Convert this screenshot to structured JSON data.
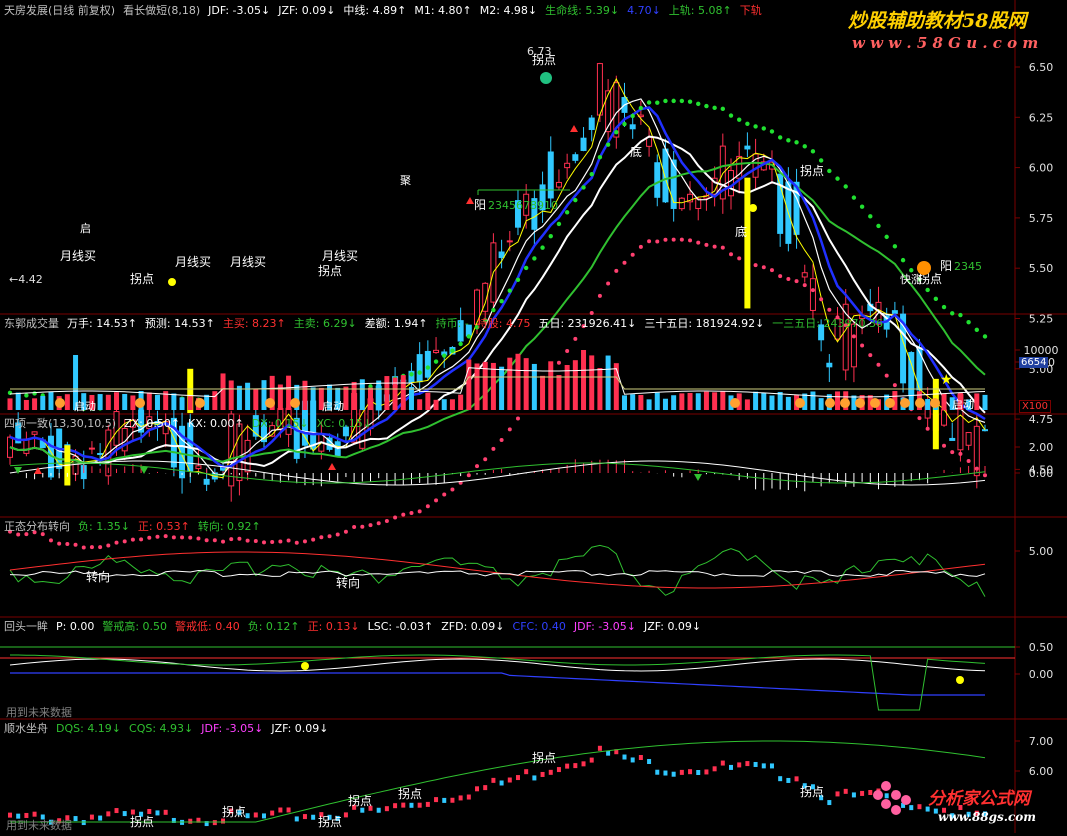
{
  "colors": {
    "bg": "#000000",
    "grid": "#7a0000",
    "up": "#ff3050",
    "down": "#30c8ff",
    "white": "#ffffff",
    "yellow": "#ffff00",
    "green": "#30c030",
    "lgreen": "#20e030",
    "magenta": "#ff40ff",
    "pink": "#ff4070",
    "blue": "#3040ff",
    "text": "#c0c0c0"
  },
  "watermark": {
    "top": "炒股辅助教材58股网",
    "top_url": "w w w . 5 8 G u . c o m",
    "bottom": "分析家公式网",
    "bottom_url": "www.88gs.com"
  },
  "panel1": {
    "items": [
      {
        "t": "天房发展(日线 前复权)",
        "c": "#c0c0c0"
      },
      {
        "t": "看长做短(8,18)",
        "c": "#c0c0c0"
      },
      {
        "t": "JDF: -3.05↓",
        "c": "#ffffff"
      },
      {
        "t": "JZF: 0.09↓",
        "c": "#ffffff"
      },
      {
        "t": "中线: 4.89↑",
        "c": "#ffffff"
      },
      {
        "t": "M1: 4.80↑",
        "c": "#ffffff"
      },
      {
        "t": "M2: 4.98↓",
        "c": "#ffffff"
      },
      {
        "t": "生命线: 5.39↓",
        "c": "#30c030"
      },
      {
        "t": "4.70↓",
        "c": "#3040ff"
      },
      {
        "t": "上轨: 5.08↑",
        "c": "#30c030"
      },
      {
        "t": "下轨",
        "c": "#ff3030"
      }
    ],
    "y_ticks": [
      "6.50",
      "6.25",
      "6.00",
      "5.75",
      "5.50",
      "5.25",
      "5.00",
      "4.75",
      "4.50"
    ],
    "labels": {
      "hi": "6.73",
      "lo": "←4.42",
      "turn": "拐点",
      "bottom": "底",
      "yang": "阳",
      "yang_seq": "2345678910",
      "yang_seq2": "2345",
      "month_buy": "月线买",
      "month_buy2": "月线买",
      "month_buy3": "月线买",
      "month_buy4": "月线买",
      "ju": "聚",
      "turn2": "拐点",
      "turn3": "拐点",
      "turn4": "拐点",
      "turn5": "拐点",
      "bottom2": "底",
      "quick_rise": "快涨",
      "start": "启"
    }
  },
  "panel2": {
    "items": [
      {
        "t": "东郭成交量",
        "c": "#c0c0c0"
      },
      {
        "t": "万手: 14.53↑",
        "c": "#ffffff"
      },
      {
        "t": "预测: 14.53↑",
        "c": "#ffffff"
      },
      {
        "t": "主买: 8.23↑",
        "c": "#ff3030"
      },
      {
        "t": "主卖: 6.29↓",
        "c": "#30c030"
      },
      {
        "t": "差额: 1.94↑",
        "c": "#ffffff"
      },
      {
        "t": "持币: -",
        "c": "#30c030"
      },
      {
        "t": "持股: 4.75",
        "c": "#ff3030"
      },
      {
        "t": "五日: 231926.41↓",
        "c": "#ffffff"
      },
      {
        "t": "三十五日: 181924.92↓",
        "c": "#ffffff"
      },
      {
        "t": "一三五日: 243970.36",
        "c": "#30c030"
      }
    ],
    "y_ticks": [
      "10000",
      "5000"
    ],
    "current": "6654",
    "unit": "X100",
    "labels": {
      "start": "启动",
      "start2": "启动",
      "start3": "启动"
    }
  },
  "panel3": {
    "items": [
      {
        "t": "四项一致(13,30,10,5)",
        "c": "#c0c0c0"
      },
      {
        "t": "ZX: 0.50↑",
        "c": "#ffffff"
      },
      {
        "t": "KX: 0.00↑",
        "c": "#ffffff"
      },
      {
        "t": "DX: 0.15↓",
        "c": "#30c030"
      },
      {
        "t": "XC: 0.15↓",
        "c": "#30c030"
      }
    ],
    "y_ticks": [
      "2.00",
      "0.00"
    ]
  },
  "panel4": {
    "items": [
      {
        "t": "正态分布转向",
        "c": "#c0c0c0"
      },
      {
        "t": "负: 1.35↓",
        "c": "#30c030"
      },
      {
        "t": "正: 0.53↑",
        "c": "#ff3030"
      },
      {
        "t": "转向: 0.92↑",
        "c": "#30c030"
      }
    ],
    "y_ticks": [
      "5.00"
    ],
    "labels": {
      "turn": "转向",
      "turn2": "转向"
    }
  },
  "panel5": {
    "items": [
      {
        "t": "回头一眸",
        "c": "#c0c0c0"
      },
      {
        "t": "P: 0.00",
        "c": "#ffffff"
      },
      {
        "t": "警戒高: 0.50",
        "c": "#30c030"
      },
      {
        "t": "警戒低: 0.40",
        "c": "#ff3030"
      },
      {
        "t": "负: 0.12↑",
        "c": "#30c030"
      },
      {
        "t": "正: 0.13↓",
        "c": "#ff3030"
      },
      {
        "t": "LSC: -0.03↑",
        "c": "#ffffff"
      },
      {
        "t": "ZFD: 0.09↓",
        "c": "#ffffff"
      },
      {
        "t": "CFC: 0.40",
        "c": "#3040ff"
      },
      {
        "t": "JDF: -3.05↓",
        "c": "#ff40ff"
      },
      {
        "t": "JZF: 0.09↓",
        "c": "#ffffff"
      }
    ],
    "y_ticks": [
      "0.50",
      "0.00"
    ],
    "footer": "用到未来数据"
  },
  "panel6": {
    "items": [
      {
        "t": "顺水坐舟",
        "c": "#c0c0c0"
      },
      {
        "t": "DQS: 4.19↓",
        "c": "#30c030"
      },
      {
        "t": "CQS: 4.93↓",
        "c": "#30c030"
      },
      {
        "t": "JDF: -3.05↓",
        "c": "#ff40ff"
      },
      {
        "t": "JZF: 0.09↓",
        "c": "#ffffff"
      }
    ],
    "y_ticks": [
      "7.00",
      "6.00"
    ],
    "footer": "用到未来数据",
    "labels": {
      "turn": "拐点",
      "turn2": "拐点",
      "turn3": "拐点",
      "turn4": "拐点",
      "turn5": "拐点",
      "turn6": "拐点",
      "turn7": "拐点"
    }
  },
  "chart_data": {
    "type": "candlestick",
    "title": "天房发展(日线 前复权)",
    "y_range": [
      4.42,
      6.73
    ],
    "high": 6.73,
    "low": 4.42,
    "last": {
      "jdf": -3.05,
      "jzf": 0.09,
      "mid_line": 4.89,
      "m1": 4.8,
      "m2": 4.98,
      "life_line": 5.39,
      "upper_rail": 5.08
    },
    "volume": {
      "wan_shou": 14.53,
      "forecast": 14.53,
      "main_buy": 8.23,
      "main_sell": 6.29,
      "diff": 1.94,
      "hold_stock": 4.75,
      "ma5": 231926.41,
      "ma35": 181924.92,
      "ma135": 243970.36,
      "current": 6654
    },
    "indicators": {
      "four_consistent": {
        "zx": 0.5,
        "kx": 0.0,
        "dx": 0.15,
        "xc": 0.15
      },
      "normal_turn": {
        "neg": 1.35,
        "pos": 0.53,
        "turn": 0.92
      },
      "look_back": {
        "p": 0.0,
        "warn_high": 0.5,
        "warn_low": 0.4,
        "neg": 0.12,
        "pos": 0.13,
        "lsc": -0.03,
        "zfd": 0.09,
        "cfc": 0.4,
        "jdf": -3.05,
        "jzf": 0.09
      },
      "go_with_flow": {
        "dqs": 4.19,
        "cqs": 4.93,
        "jdf": -3.05,
        "jzf": 0.09
      }
    }
  }
}
